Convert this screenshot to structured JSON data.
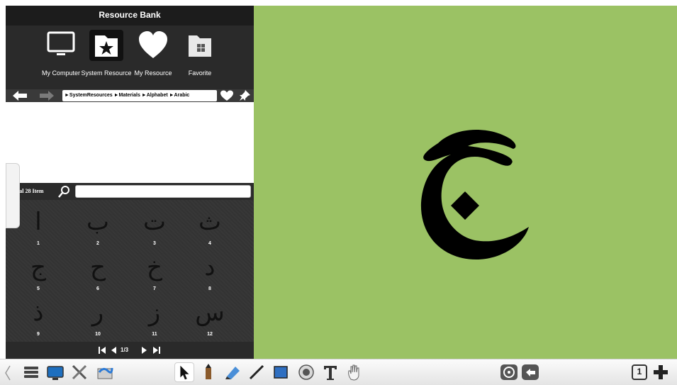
{
  "panel": {
    "title": "Resource Bank",
    "categories": [
      {
        "label": "My Computer",
        "icon": "monitor-icon"
      },
      {
        "label": "System Resource",
        "icon": "star-folder-icon"
      },
      {
        "label": "My Resource",
        "icon": "heart-icon"
      },
      {
        "label": "Favorite",
        "icon": "windows-folder-icon"
      }
    ],
    "breadcrumb": "►SystemResources ►Materials ►Alphabet ►Arabic",
    "total_label": "Total 28 Item",
    "search_value": "",
    "items": [
      {
        "glyph": "ا",
        "num": "1"
      },
      {
        "glyph": "ب",
        "num": "2"
      },
      {
        "glyph": "ت",
        "num": "3"
      },
      {
        "glyph": "ث",
        "num": "4"
      },
      {
        "glyph": "ج",
        "num": "5"
      },
      {
        "glyph": "ح",
        "num": "6"
      },
      {
        "glyph": "خ",
        "num": "7"
      },
      {
        "glyph": "د",
        "num": "8"
      },
      {
        "glyph": "ذ",
        "num": "9"
      },
      {
        "glyph": "ر",
        "num": "10"
      },
      {
        "glyph": "ز",
        "num": "11"
      },
      {
        "glyph": "س",
        "num": "12"
      }
    ],
    "page_indicator": "1/3"
  },
  "canvas": {
    "letter": "ج",
    "background": "#9bc264"
  },
  "toolbar": {
    "left_icons": [
      "menu-icon",
      "screen-icon",
      "tools-icon",
      "ink-folder-icon"
    ],
    "drawing_icons": [
      "pointer-icon",
      "pencil-icon",
      "highlighter-icon",
      "line-icon",
      "rectangle-icon",
      "eraser-icon",
      "text-icon",
      "hand-icon"
    ],
    "right_icons": [
      "target-icon",
      "undo-icon",
      "page-icon",
      "add-icon"
    ],
    "page_number": "1"
  }
}
